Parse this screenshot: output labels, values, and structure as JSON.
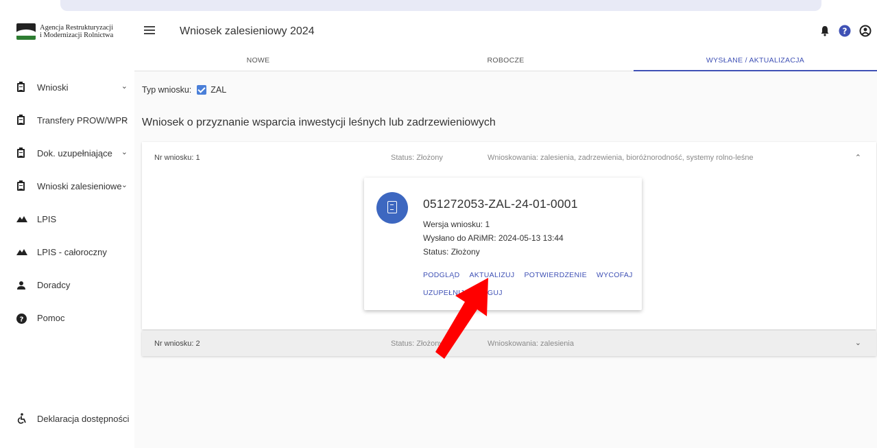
{
  "sidebar": {
    "logo_line1": "Agencja Restrukturyzacji",
    "logo_line2": "i Modernizacji Rolnictwa",
    "items": [
      {
        "label": "Wnioski",
        "icon": "clipboard-icon",
        "expandable": true
      },
      {
        "label": "Transfery PROW/WPR",
        "icon": "clipboard-icon",
        "expandable": true
      },
      {
        "label": "Dok. uzupełniające",
        "icon": "clipboard-icon",
        "expandable": true
      },
      {
        "label": "Wnioski zalesieniowe",
        "icon": "clipboard-icon",
        "expandable": true
      },
      {
        "label": "LPIS",
        "icon": "terrain-icon",
        "expandable": false
      },
      {
        "label": "LPIS - całoroczny",
        "icon": "terrain-icon",
        "expandable": false
      },
      {
        "label": "Doradcy",
        "icon": "person-icon",
        "expandable": false
      },
      {
        "label": "Pomoc",
        "icon": "help-icon",
        "expandable": false
      }
    ],
    "accessibility_label": "Deklaracja dostępności"
  },
  "header": {
    "title": "Wniosek zalesieniowy 2024",
    "icons": [
      "notification-bell-icon",
      "help-icon",
      "account-icon"
    ]
  },
  "tabs": [
    {
      "label": "NOWE",
      "active": false
    },
    {
      "label": "ROBOCZE",
      "active": false
    },
    {
      "label": "WYSŁANE / AKTUALIZACJA",
      "active": true
    }
  ],
  "filter": {
    "label": "Typ wniosku:",
    "option_label": "ZAL",
    "checked": true
  },
  "section_title": "Wniosek o przyznanie wsparcia inwestycji leśnych lub zadrzewieniowych",
  "applications": [
    {
      "number_label": "Nr wniosku: 1",
      "status_label": "Status: Złożony",
      "requests_label": "Wnioskowania: zalesienia, zadrzewienia, bioróżnorodność, systemy rolno-leśne",
      "expanded": true
    },
    {
      "number_label": "Nr wniosku: 2",
      "status_label": "Status: Złożony",
      "requests_label": "Wnioskowania: zalesienia",
      "expanded": false
    }
  ],
  "card": {
    "id": "051272053-ZAL-24-01-0001",
    "version": "Wersja wniosku: 1",
    "sent": "Wysłano do ARiMR: 2024-05-13 13:44",
    "status": "Status: Złożony",
    "actions": [
      "PODGLĄD",
      "AKTUALIZUJ",
      "POTWIERDZENIE",
      "WYCOFAJ"
    ],
    "action_second_row": "UZUPEŁNIJ/KORYGUJ"
  },
  "colors": {
    "accent": "#3f51b5",
    "doc_icon_bg": "#3d67c0",
    "checkbox": "#4a7fd8",
    "annotation_arrow": "#ff0000"
  }
}
